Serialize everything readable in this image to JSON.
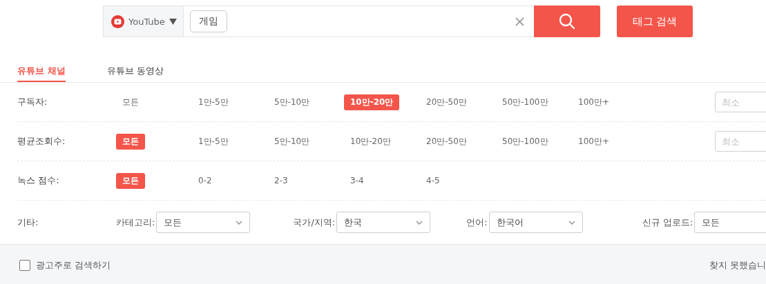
{
  "search": {
    "platform": "YouTube",
    "tags": [
      "게임"
    ],
    "tag_search_label": "태그 검색"
  },
  "tabs": [
    {
      "label": "유튜브 채널",
      "selected": true
    },
    {
      "label": "유튜브 동영상",
      "selected": false
    }
  ],
  "filters": [
    {
      "label": "구독자:",
      "min_placeholder": "최소",
      "options": [
        {
          "label": "모든",
          "selected": false
        },
        {
          "label": "1만-5만",
          "selected": false
        },
        {
          "label": "5만-10만",
          "selected": false
        },
        {
          "label": "10만-20만",
          "selected": true
        },
        {
          "label": "20만-50만",
          "selected": false
        },
        {
          "label": "50만-100만",
          "selected": false
        },
        {
          "label": "100만+",
          "selected": false
        }
      ]
    },
    {
      "label": "평균조회수:",
      "min_placeholder": "최소",
      "options": [
        {
          "label": "모든",
          "selected": true
        },
        {
          "label": "1만-5만",
          "selected": false
        },
        {
          "label": "5만-10만",
          "selected": false
        },
        {
          "label": "10만-20만",
          "selected": false
        },
        {
          "label": "20만-50만",
          "selected": false
        },
        {
          "label": "50만-100만",
          "selected": false
        },
        {
          "label": "100만+",
          "selected": false
        }
      ]
    },
    {
      "label": "녹스 점수:",
      "options": [
        {
          "label": "모든",
          "selected": true
        },
        {
          "label": "0-2",
          "selected": false
        },
        {
          "label": "2-3",
          "selected": false
        },
        {
          "label": "3-4",
          "selected": false
        },
        {
          "label": "4-5",
          "selected": false
        }
      ]
    }
  ],
  "other": {
    "label": "기타:",
    "dropdowns": [
      {
        "label": "카테고리:",
        "value": "모든"
      },
      {
        "label": "국가/지역:",
        "value": "한국"
      },
      {
        "label": "언어:",
        "value": "한국어"
      },
      {
        "label": "신규 업로드:",
        "value": "모든"
      }
    ]
  },
  "footer": {
    "advertiser_filter": {
      "label": "광고주로 검색하기",
      "checked": false
    },
    "status": "찾지 못했습니"
  }
}
